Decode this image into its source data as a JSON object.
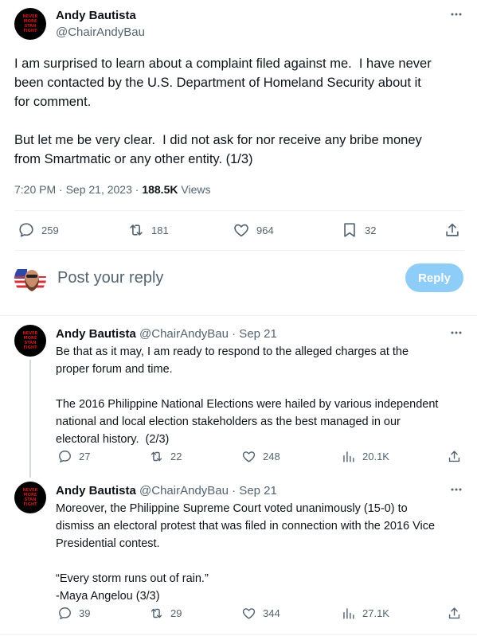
{
  "main_tweet": {
    "author_name": "Andy Bautista",
    "author_handle": "@ChairAndyBau",
    "avatar_text": "NEVER MORE\nSTAN FIGHT",
    "text": "I am surprised to learn about a complaint filed against me.  I have never\nbeen contacted by the U.S. Department of Homeland Security about it\nfor comment.\n\nBut let me be very clear.  I did not ask for nor receive any bribe money\nfrom Smartmatic or any other entity. (1/3)",
    "time_date": "7:20 PM · Sep 21, 2023 · ",
    "views_count": "188.5K",
    "views_label": " Views",
    "replies": "259",
    "retweets": "181",
    "likes": "964",
    "bookmarks": "32"
  },
  "reply_box": {
    "placeholder": "Post your reply",
    "button_label": "Reply"
  },
  "replies": [
    {
      "author_name": "Andy Bautista",
      "author_handle": "@ChairAndyBau · Sep 21",
      "text": "Be that as it may, I am ready to respond to the alleged charges at the\nproper forum and time.\n\nThe 2016 Philippine National Elections were hailed by various independent\nnational and local election stakeholders as the best managed in our\nelectoral history.  (2/3)",
      "replies": "27",
      "retweets": "22",
      "likes": "248",
      "views": "20.1K"
    },
    {
      "author_name": "Andy Bautista",
      "author_handle": "@ChairAndyBau · Sep 21",
      "text": "Moreover, the Philippine Supreme Court voted unanimously (15-0) to\ndismiss an electoral protest that was filed in connection with the 2016 Vice\nPresidential contest.\n\n“Every storm runs out of rain.”\n-Maya Angelou (3/3)",
      "replies": "39",
      "retweets": "29",
      "likes": "344",
      "views": "27.1K"
    }
  ],
  "colors": {
    "accent_disabled": "#8ecdf8",
    "secondary_text": "#536471",
    "divider": "#eff3f4"
  },
  "icons": [
    "reply-icon",
    "retweet-icon",
    "like-icon",
    "bookmark-icon",
    "share-icon",
    "views-icon",
    "more-icon"
  ]
}
